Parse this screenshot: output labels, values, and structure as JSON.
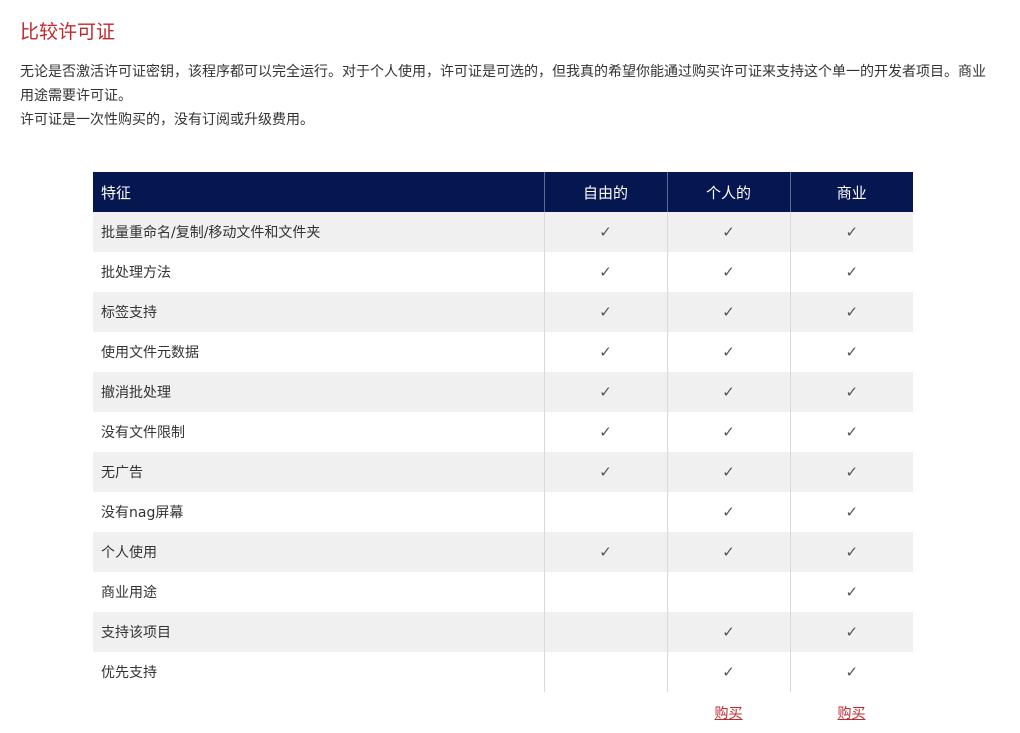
{
  "page": {
    "title": "比较许可证",
    "intro_line1": "无论是否激活许可证密钥，该程序都可以完全运行。对于个人使用，许可证是可选的，但我真的希望你能通过购买许可证来支持这个单一的开发者项目。商业用途需要许可证。",
    "intro_line2": "许可证是一次性购买的，没有订阅或升级费用。"
  },
  "table": {
    "headers": {
      "feature": "特征",
      "free": "自由的",
      "personal": "个人的",
      "business": "商业"
    },
    "check_glyph": "✓",
    "rows": [
      {
        "feature": "批量重命名/复制/移动文件和文件夹",
        "free": "✓",
        "personal": "✓",
        "business": "✓"
      },
      {
        "feature": "批处理方法",
        "free": "✓",
        "personal": "✓",
        "business": "✓"
      },
      {
        "feature": "标签支持",
        "free": "✓",
        "personal": "✓",
        "business": "✓"
      },
      {
        "feature": "使用文件元数据",
        "free": "✓",
        "personal": "✓",
        "business": "✓"
      },
      {
        "feature": "撤消批处理",
        "free": "✓",
        "personal": "✓",
        "business": "✓"
      },
      {
        "feature": "没有文件限制",
        "free": "✓",
        "personal": "✓",
        "business": "✓"
      },
      {
        "feature": "无广告",
        "free": "✓",
        "personal": "✓",
        "business": "✓"
      },
      {
        "feature": "没有nag屏幕",
        "free": "",
        "personal": "✓",
        "business": "✓"
      },
      {
        "feature": "个人使用",
        "free": "✓",
        "personal": "✓",
        "business": "✓"
      },
      {
        "feature": "商业用途",
        "free": "",
        "personal": "",
        "business": "✓"
      },
      {
        "feature": "支持该项目",
        "free": "",
        "personal": "✓",
        "business": "✓"
      },
      {
        "feature": "优先支持",
        "free": "",
        "personal": "✓",
        "business": "✓"
      }
    ],
    "buy": {
      "personal_label": "购买",
      "business_label": "购买"
    }
  },
  "colors": {
    "title_red": "#c0282e",
    "header_navy": "#061651",
    "row_stripe": "#f0f0f0",
    "link_red": "#c0282e"
  }
}
